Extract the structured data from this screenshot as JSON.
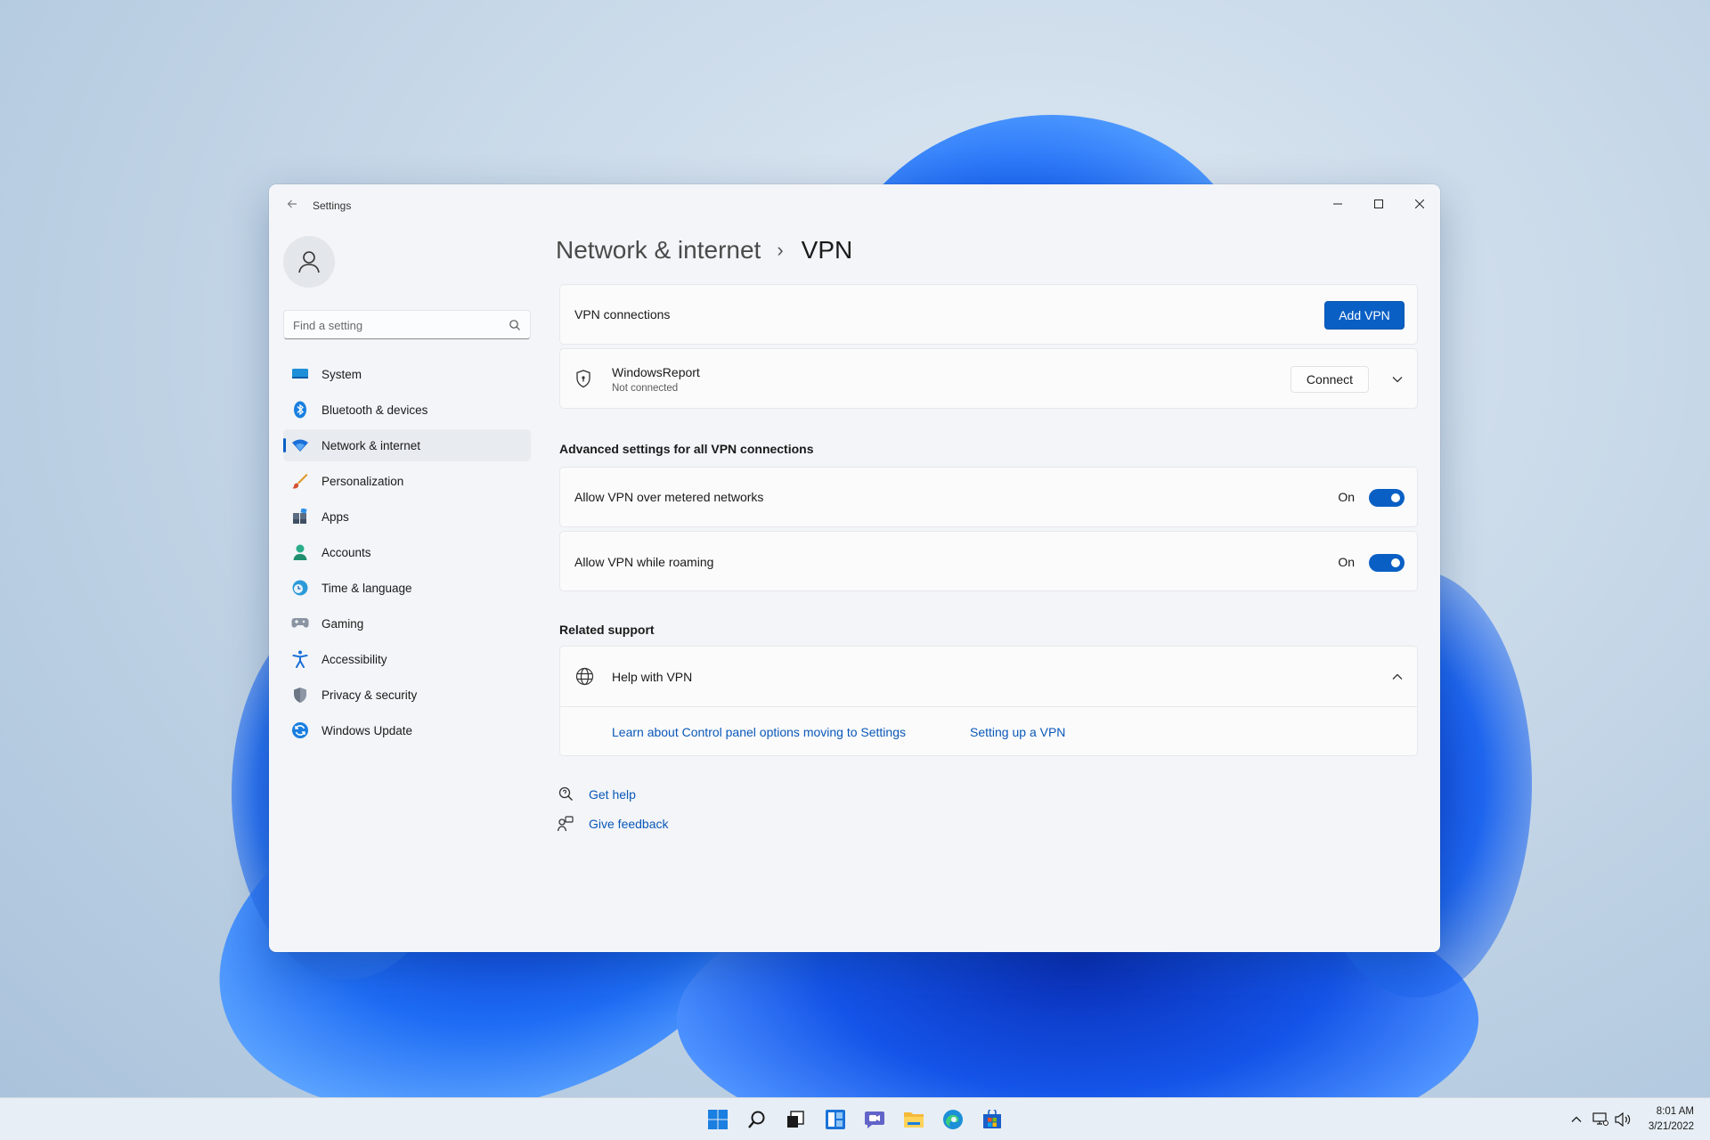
{
  "window": {
    "title": "Settings"
  },
  "search": {
    "placeholder": "Find a setting"
  },
  "sidebar": {
    "items": [
      {
        "label": "System",
        "icon": "display-icon"
      },
      {
        "label": "Bluetooth & devices",
        "icon": "bluetooth-icon"
      },
      {
        "label": "Network & internet",
        "icon": "wifi-icon",
        "active": true
      },
      {
        "label": "Personalization",
        "icon": "brush-icon"
      },
      {
        "label": "Apps",
        "icon": "apps-icon"
      },
      {
        "label": "Accounts",
        "icon": "person-icon"
      },
      {
        "label": "Time & language",
        "icon": "globe-clock-icon"
      },
      {
        "label": "Gaming",
        "icon": "gamepad-icon"
      },
      {
        "label": "Accessibility",
        "icon": "accessibility-icon"
      },
      {
        "label": "Privacy & security",
        "icon": "shield-icon"
      },
      {
        "label": "Windows Update",
        "icon": "refresh-icon"
      }
    ]
  },
  "breadcrumb": {
    "parent": "Network & internet",
    "separator": "›",
    "current": "VPN"
  },
  "vpn": {
    "connections_label": "VPN connections",
    "add_button": "Add VPN",
    "connection": {
      "name": "WindowsReport",
      "status": "Not connected",
      "connect_button": "Connect"
    }
  },
  "advanced": {
    "title": "Advanced settings for all VPN connections",
    "metered": {
      "label": "Allow VPN over metered networks",
      "state": "On",
      "enabled": true
    },
    "roaming": {
      "label": "Allow VPN while roaming",
      "state": "On",
      "enabled": true
    }
  },
  "related": {
    "title": "Related support",
    "help_title": "Help with VPN",
    "links": [
      "Learn about Control panel options moving to Settings",
      "Setting up a VPN"
    ]
  },
  "footer": {
    "get_help": "Get help",
    "give_feedback": "Give feedback"
  },
  "taskbar": {
    "apps": [
      "windows-start-icon",
      "search-icon",
      "task-view-icon",
      "widgets-icon",
      "chat-icon",
      "file-explorer-icon",
      "edge-icon",
      "store-icon"
    ],
    "time": "8:01 AM",
    "date": "3/21/2022"
  },
  "colors": {
    "accent": "#0a5fc4",
    "link": "#0a58b8",
    "window_bg": "#f3f5f8",
    "card_bg": "#fbfbfc"
  }
}
